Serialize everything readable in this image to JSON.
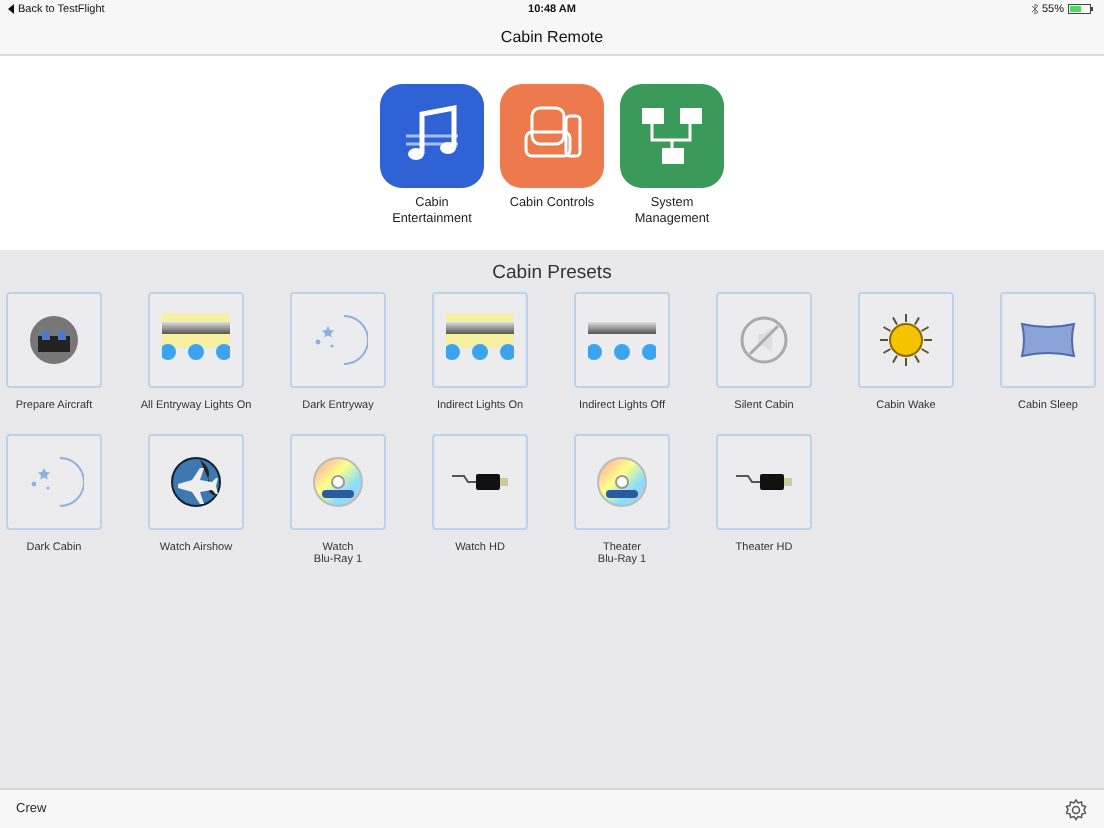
{
  "status_bar": {
    "back_link": "Back to TestFlight",
    "time": "10:48 AM",
    "battery": "55%"
  },
  "nav_bar": {
    "title": "Cabin Remote"
  },
  "apps": [
    {
      "label": "Cabin\nEntertainment",
      "kind": "music",
      "color": "#2f62d4"
    },
    {
      "label": "Cabin Controls",
      "kind": "seat",
      "color": "#ec7a4c"
    },
    {
      "label": "System\nManagement",
      "kind": "network",
      "color": "#3a9a5a"
    }
  ],
  "presets_title": "Cabin Presets",
  "presets": [
    {
      "label": "Prepare Aircraft",
      "kind": "cockpit"
    },
    {
      "label": "All Entryway Lights On",
      "kind": "lights-on"
    },
    {
      "label": "Dark Entryway",
      "kind": "moon"
    },
    {
      "label": "Indirect Lights On",
      "kind": "lights-on"
    },
    {
      "label": "Indirect Lights Off",
      "kind": "lights-off"
    },
    {
      "label": "Silent Cabin",
      "kind": "mute"
    },
    {
      "label": "Cabin Wake",
      "kind": "sun"
    },
    {
      "label": "Cabin Sleep",
      "kind": "pillow"
    },
    {
      "label": "Dark Cabin",
      "kind": "moon"
    },
    {
      "label": "Watch Airshow",
      "kind": "globe"
    },
    {
      "label": "Watch\nBlu-Ray 1",
      "kind": "disc"
    },
    {
      "label": "Watch HD",
      "kind": "cable"
    },
    {
      "label": "Theater\nBlu-Ray 1",
      "kind": "disc"
    },
    {
      "label": "Theater HD",
      "kind": "cable"
    }
  ],
  "toolbar": {
    "label": "Crew"
  }
}
